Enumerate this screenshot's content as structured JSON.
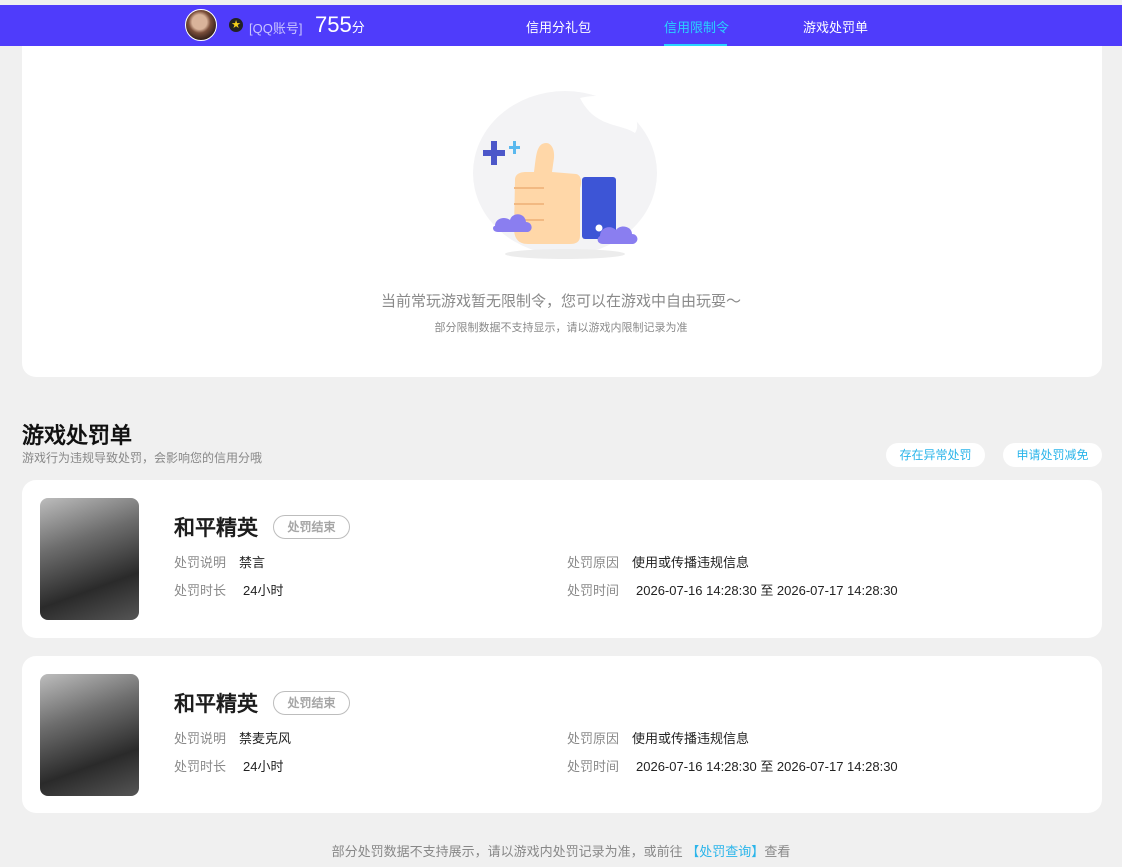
{
  "header": {
    "account_label": "[QQ账号]",
    "score": "755",
    "score_unit": "分",
    "nav": [
      {
        "label": "信用分礼包",
        "active": false
      },
      {
        "label": "信用限制令",
        "active": true
      },
      {
        "label": "游戏处罚单",
        "active": false
      }
    ]
  },
  "restriction": {
    "empty_message": "当前常玩游戏暂无限制令，您可以在游戏中自由玩耍～",
    "empty_note": "部分限制数据不支持显示，请以游戏内限制记录为准"
  },
  "penalty_section": {
    "title": "游戏处罚单",
    "subtitle": "游戏行为违规导致处罚，会影响您的信用分哦",
    "button_abnormal": "存在异常处罚",
    "button_reduce": "申请处罚减免",
    "labels": {
      "desc": "处罚说明",
      "duration": "处罚时长",
      "reason": "处罚原因",
      "time": "处罚时间"
    },
    "items": [
      {
        "game": "和平精英",
        "status": "处罚结束",
        "desc": "禁言",
        "duration": "24小时",
        "reason": "使用或传播违规信息",
        "time": "2026-07-16 14:28:30 至 2026-07-17 14:28:30"
      },
      {
        "game": "和平精英",
        "status": "处罚结束",
        "desc": "禁麦克风",
        "duration": "24小时",
        "reason": "使用或传播违规信息",
        "time": "2026-07-16 14:28:30 至 2026-07-17 14:28:30"
      }
    ]
  },
  "footer": {
    "text_before": "部分处罚数据不支持展示，请以游戏内处罚记录为准，或前往",
    "link": "【处罚查询】",
    "text_after": "查看"
  },
  "colors": {
    "brand": "#4f3cfb",
    "accent": "#29d3ff",
    "link": "#2bb5ea"
  }
}
